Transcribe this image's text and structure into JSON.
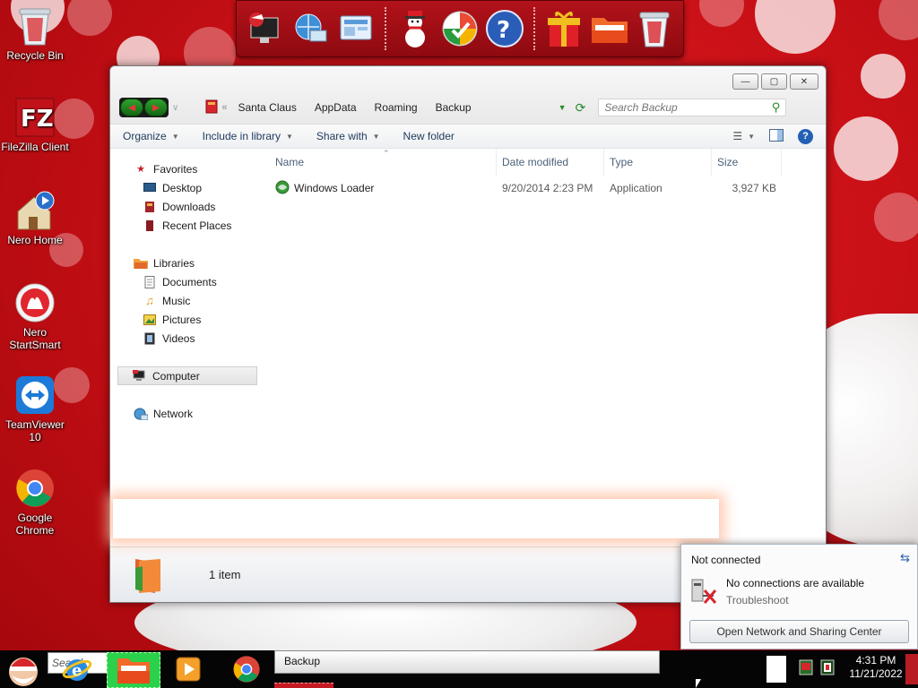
{
  "colors": {
    "wallpaper_red": "#c81016",
    "accent_green": "#2a8a2a",
    "link_blue": "#1e395b",
    "taskbar": "#050505"
  },
  "desktop_icons": [
    {
      "label": "Recycle Bin",
      "icon": "recycle-bin-icon"
    },
    {
      "label": "FileZilla Client",
      "icon": "filezilla-icon"
    },
    {
      "label": "Nero Home",
      "icon": "nero-home-icon"
    },
    {
      "label": "Nero StartSmart",
      "icon": "nero-startsmart-icon"
    },
    {
      "label": "TeamViewer 10",
      "icon": "teamviewer-icon"
    },
    {
      "label": "Google Chrome",
      "icon": "chrome-icon"
    }
  ],
  "dock_icons": [
    "computer-icon",
    "network-icon",
    "control-panel-icon",
    "snowman-icon",
    "windows-update-icon",
    "help-icon",
    "gift-icon",
    "folder-icon",
    "recycle-bin-icon"
  ],
  "window": {
    "breadcrumb": [
      "Santa Claus",
      "AppData",
      "Roaming",
      "Backup"
    ],
    "search_placeholder": "Search Backup",
    "commands": [
      "Organize",
      "Include in library",
      "Share with",
      "New folder"
    ],
    "nav": {
      "favorites_label": "Favorites",
      "favorites": [
        "Desktop",
        "Downloads",
        "Recent Places"
      ],
      "libraries_label": "Libraries",
      "libraries": [
        "Documents",
        "Music",
        "Pictures",
        "Videos"
      ],
      "computer_label": "Computer",
      "network_label": "Network"
    },
    "columns": {
      "name": "Name",
      "date": "Date modified",
      "type": "Type",
      "size": "Size"
    },
    "files": [
      {
        "name": "Windows Loader",
        "date": "9/20/2014 2:23 PM",
        "type": "Application",
        "size": "3,927 KB"
      }
    ],
    "details": {
      "item_count": "1 item"
    }
  },
  "network_flyout": {
    "title": "Not connected",
    "message": "No connections are available",
    "troubleshoot": "Troubleshoot",
    "open_center": "Open Network and Sharing Center"
  },
  "taskbar": {
    "search_text": "Search",
    "active_window": "Backup",
    "time": "4:31 PM",
    "date": "11/21/2022"
  }
}
